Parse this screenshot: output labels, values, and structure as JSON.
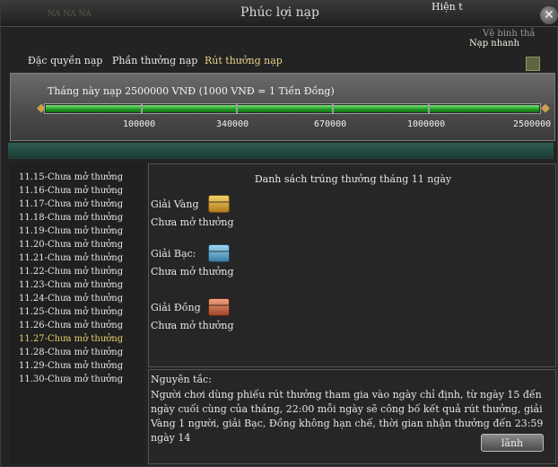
{
  "window": {
    "title": "Phúc lợi nạp",
    "corner_game_text": "NA NA NA",
    "close_symbol": "✕"
  },
  "overlay": {
    "hien_t": "Hiện t",
    "ve_binh": "Vệ binh thả",
    "nap_nhanh": "Nạp nhanh"
  },
  "tabs": [
    {
      "label": "Đặc quyền nạp",
      "active": false
    },
    {
      "label": "Phần thưởng nạp",
      "active": false
    },
    {
      "label": "Rút thưởng nạp",
      "active": true
    }
  ],
  "progress": {
    "text": "Tháng này nạp 2500000 VNĐ (1000 VNĐ = 1 Tiền Đồng)",
    "current": 2500000,
    "max": 2500000,
    "fill_fraction": 1.0,
    "ticks": [
      "100000",
      "340000",
      "670000",
      "1000000",
      "2500000"
    ]
  },
  "days": [
    {
      "label": "11.15-Chưa mở thưởng",
      "selected": false
    },
    {
      "label": "11.16-Chưa mở thưởng",
      "selected": false
    },
    {
      "label": "11.17-Chưa mở thưởng",
      "selected": false
    },
    {
      "label": "11.18-Chưa mở thưởng",
      "selected": false
    },
    {
      "label": "11.19-Chưa mở thưởng",
      "selected": false
    },
    {
      "label": "11.20-Chưa mở thưởng",
      "selected": false
    },
    {
      "label": "11.21-Chưa mở thưởng",
      "selected": false
    },
    {
      "label": "11.22-Chưa mở thưởng",
      "selected": false
    },
    {
      "label": "11.23-Chưa mở thưởng",
      "selected": false
    },
    {
      "label": "11.24-Chưa mở thưởng",
      "selected": false
    },
    {
      "label": "11.25-Chưa mở thưởng",
      "selected": false
    },
    {
      "label": "11.26-Chưa mở thưởng",
      "selected": false
    },
    {
      "label": "11.27-Chưa mở thưởng",
      "selected": true
    },
    {
      "label": "11.28-Chưa mở thưởng",
      "selected": false
    },
    {
      "label": "11.29-Chưa mở thưởng",
      "selected": false
    },
    {
      "label": "11.30-Chưa mở thưởng",
      "selected": false
    }
  ],
  "winners": {
    "title": "Danh sách trúng thưởng tháng 11 ngày",
    "prizes": [
      {
        "label": "Giải Vàng",
        "icon": "gold-chest-icon",
        "status": "Chưa mở thưởng"
      },
      {
        "label": "Giải Bạc:",
        "icon": "silver-chest-icon",
        "status": "Chưa mở thưởng"
      },
      {
        "label": "Giải Đồng",
        "icon": "bronze-chest-icon",
        "status": "Chưa mở thưởng"
      }
    ]
  },
  "rules": {
    "title": "Nguyên tắc:",
    "text": "Người chơi dùng phiếu rút thưởng tham gia vào ngày chỉ định, từ ngày 15 đến ngày cuối cùng của tháng, 22:00 mỗi ngày sẽ công bố kết quả rút thưởng, giải Vàng 1 người, giải Bạc, Đồng không hạn chế, thời gian nhận thưởng đến 23:59 ngày 14"
  },
  "claim_button": {
    "label": "lãnh"
  },
  "colors": {
    "accent_gold": "#e6d28a",
    "progress_green": "#1f9a1f",
    "panel_bg": "#232323"
  }
}
